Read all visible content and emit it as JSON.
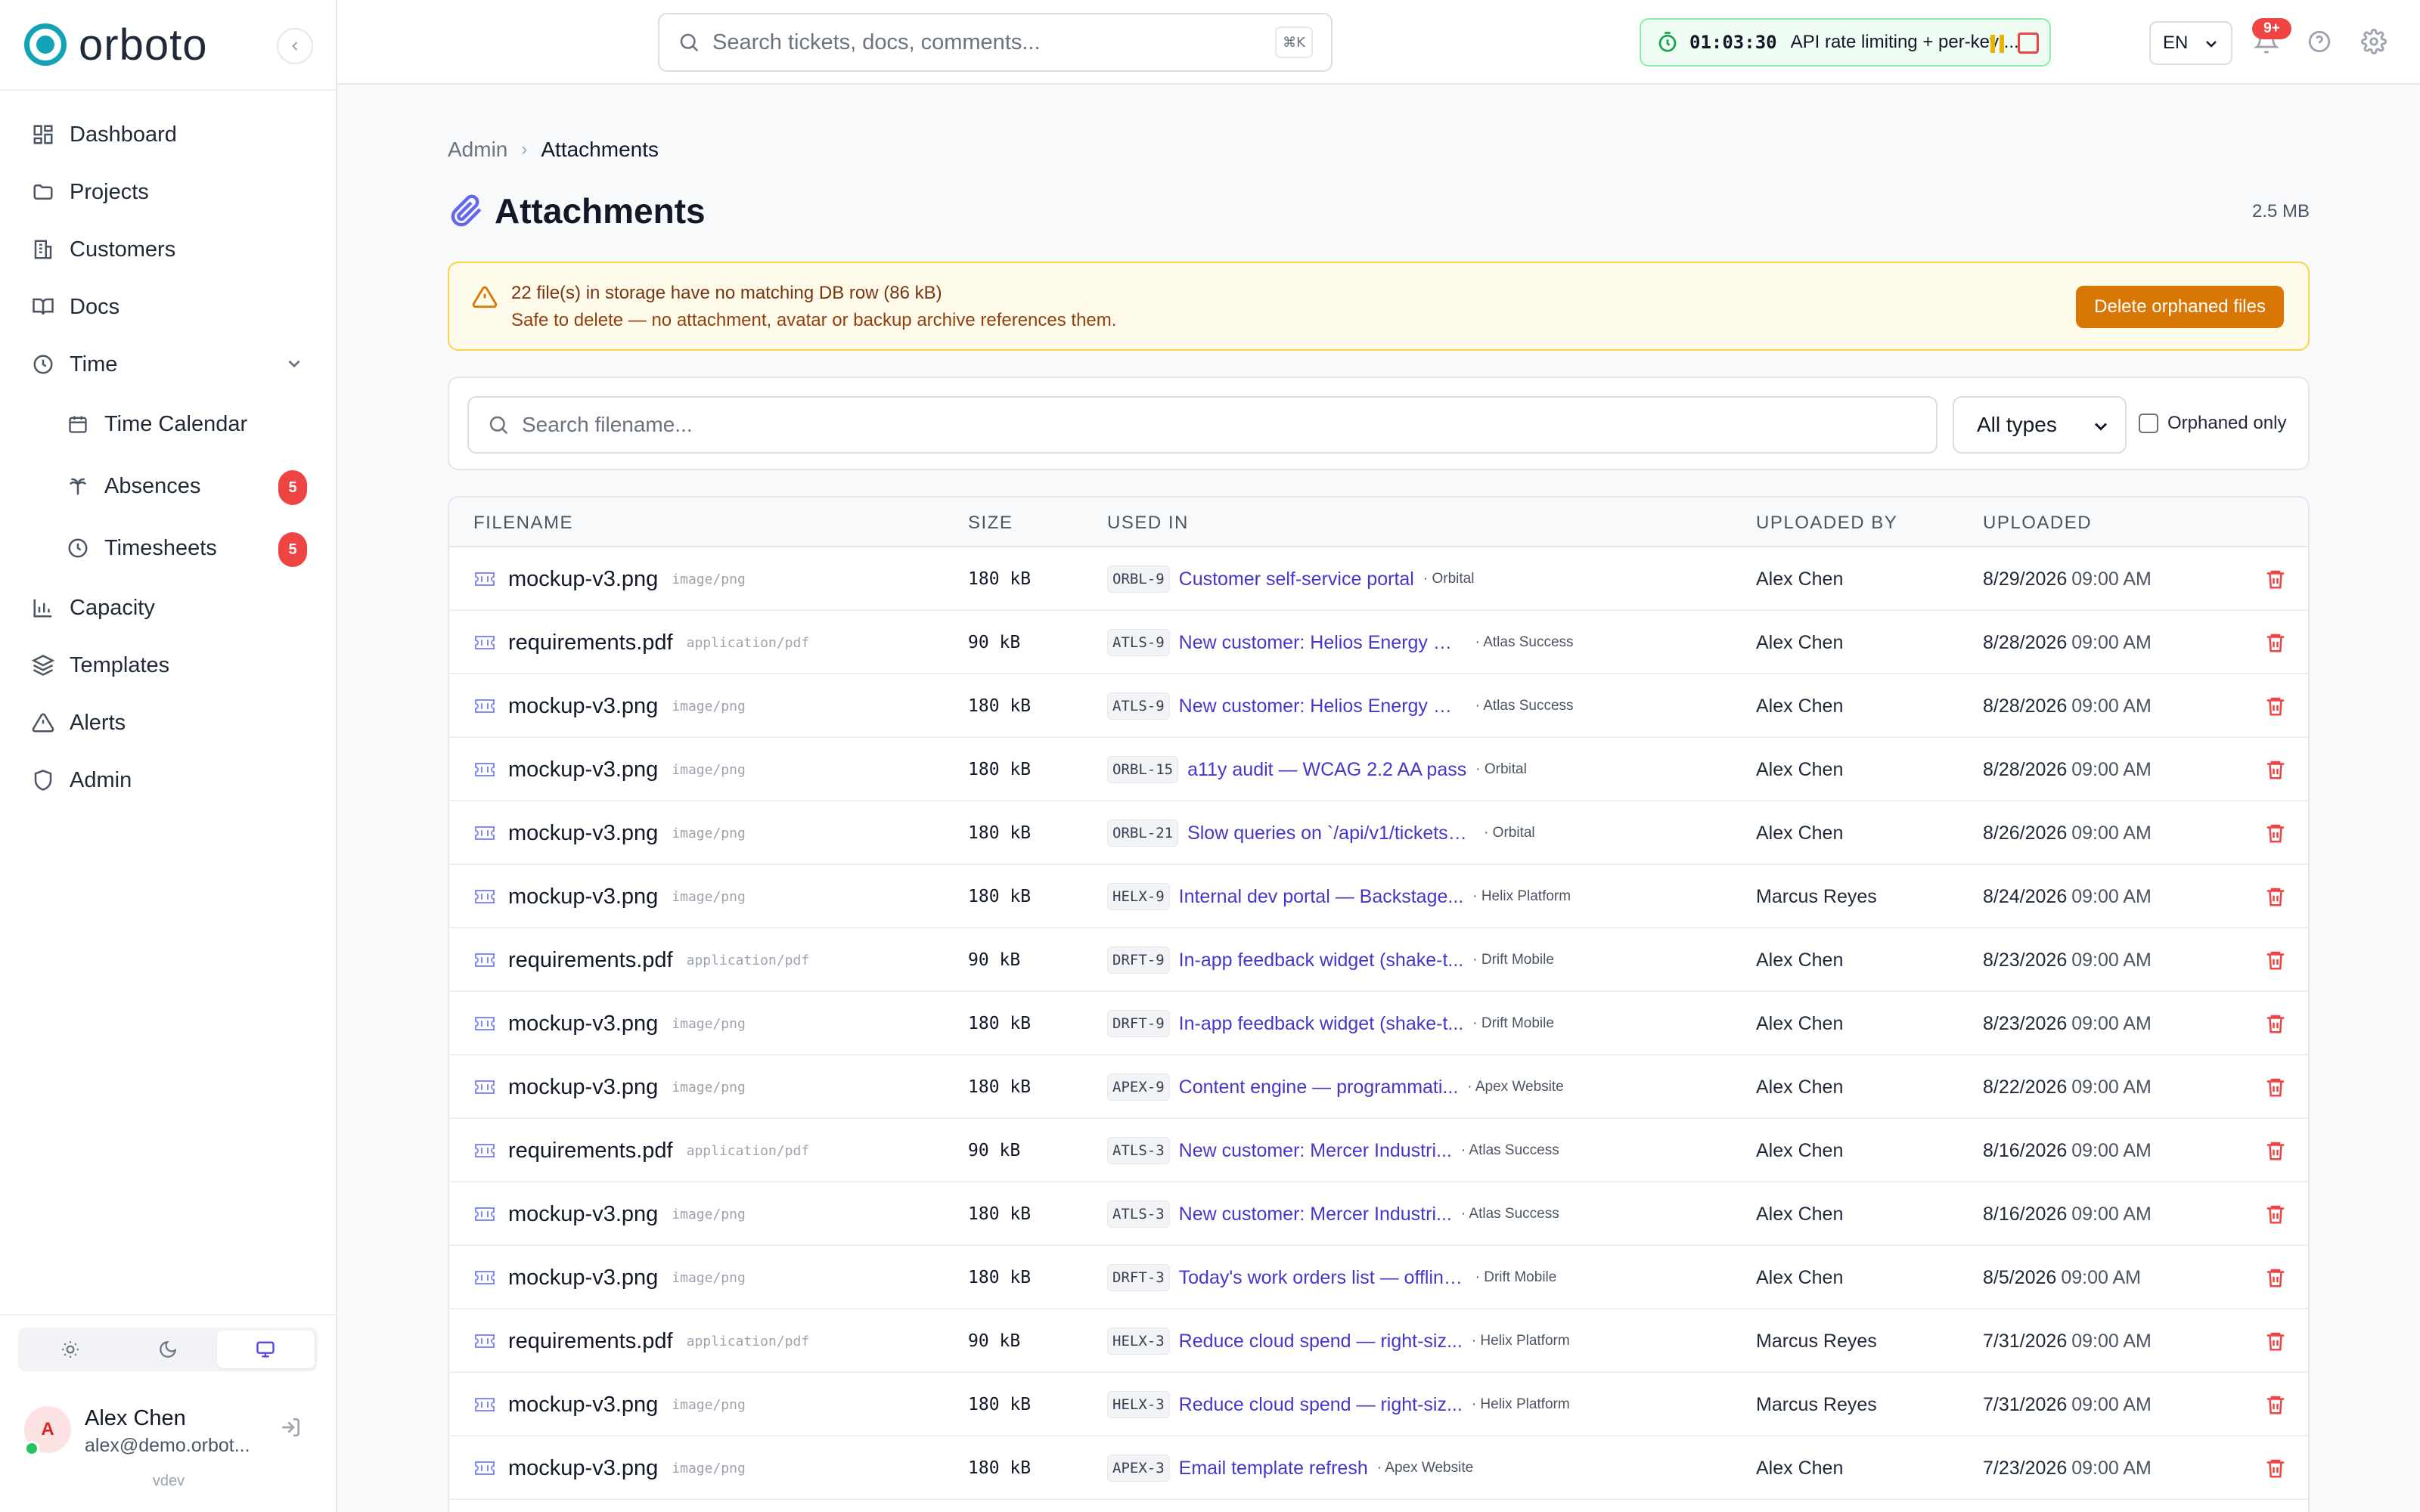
{
  "brand": {
    "name": "orboto"
  },
  "sidebar": {
    "items": [
      {
        "id": "dashboard",
        "label": "Dashboard",
        "icon": "grid-icon"
      },
      {
        "id": "projects",
        "label": "Projects",
        "icon": "folder-icon"
      },
      {
        "id": "customers",
        "label": "Customers",
        "icon": "building-icon"
      },
      {
        "id": "docs",
        "label": "Docs",
        "icon": "book-icon"
      },
      {
        "id": "time",
        "label": "Time",
        "icon": "clock-icon",
        "expanded": true
      },
      {
        "id": "time-calendar",
        "label": "Time Calendar",
        "icon": "calendar-icon",
        "sub": true
      },
      {
        "id": "absences",
        "label": "Absences",
        "icon": "palm-icon",
        "sub": true,
        "badge": "5"
      },
      {
        "id": "timesheets",
        "label": "Timesheets",
        "icon": "clock-icon",
        "sub": true,
        "badge": "5"
      },
      {
        "id": "capacity",
        "label": "Capacity",
        "icon": "bar-chart-icon"
      },
      {
        "id": "templates",
        "label": "Templates",
        "icon": "layers-icon"
      },
      {
        "id": "alerts",
        "label": "Alerts",
        "icon": "warning-icon"
      },
      {
        "id": "admin",
        "label": "Admin",
        "icon": "shield-icon"
      }
    ],
    "theme": {
      "active": "system"
    },
    "user": {
      "initial": "A",
      "name": "Alex Chen",
      "email": "alex@demo.orbot...",
      "env": "vdev"
    }
  },
  "topbar": {
    "search_placeholder": "Search tickets, docs, comments...",
    "search_shortcut": "⌘K",
    "timer": {
      "time": "01:03:30",
      "task": "API rate limiting + per-key ..."
    },
    "language": "EN",
    "notifications_badge": "9+"
  },
  "page": {
    "breadcrumb": {
      "parent": "Admin",
      "current": "Attachments"
    },
    "title": "Attachments",
    "total_size": "2.5 MB",
    "alert": {
      "title": "22 file(s) in storage have no matching DB row (86 kB)",
      "description": "Safe to delete — no attachment, avatar or backup archive references them.",
      "button": "Delete orphaned files"
    },
    "filters": {
      "search_placeholder": "Search filename...",
      "type_select": "All types",
      "orphaned_label": "Orphaned only"
    },
    "table": {
      "headers": {
        "filename": "FILENAME",
        "size": "SIZE",
        "used_in": "USED IN",
        "uploaded_by": "UPLOADED BY",
        "uploaded": "UPLOADED"
      },
      "rows": [
        {
          "filename": "mockup-v3.png",
          "mime": "image/png",
          "size": "180 kB",
          "key": "ORBL-9",
          "title": "Customer self-service portal",
          "project": "· Orbital",
          "by": "Alex Chen",
          "date": "8/29/2026",
          "time": "09:00 AM"
        },
        {
          "filename": "requirements.pdf",
          "mime": "application/pdf",
          "size": "90 kB",
          "key": "ATLS-9",
          "title": "New customer: Helios Energy —...",
          "project": "· Atlas Success",
          "by": "Alex Chen",
          "date": "8/28/2026",
          "time": "09:00 AM"
        },
        {
          "filename": "mockup-v3.png",
          "mime": "image/png",
          "size": "180 kB",
          "key": "ATLS-9",
          "title": "New customer: Helios Energy —...",
          "project": "· Atlas Success",
          "by": "Alex Chen",
          "date": "8/28/2026",
          "time": "09:00 AM"
        },
        {
          "filename": "mockup-v3.png",
          "mime": "image/png",
          "size": "180 kB",
          "key": "ORBL-15",
          "title": "a11y audit — WCAG 2.2 AA pass",
          "project": "· Orbital",
          "by": "Alex Chen",
          "date": "8/28/2026",
          "time": "09:00 AM"
        },
        {
          "filename": "mockup-v3.png",
          "mime": "image/png",
          "size": "180 kB",
          "key": "ORBL-21",
          "title": "Slow queries on `/api/v1/tickets?inclu...",
          "project": "· Orbital",
          "by": "Alex Chen",
          "date": "8/26/2026",
          "time": "09:00 AM"
        },
        {
          "filename": "mockup-v3.png",
          "mime": "image/png",
          "size": "180 kB",
          "key": "HELX-9",
          "title": "Internal dev portal — Backstage...",
          "project": "· Helix Platform",
          "by": "Marcus Reyes",
          "date": "8/24/2026",
          "time": "09:00 AM"
        },
        {
          "filename": "requirements.pdf",
          "mime": "application/pdf",
          "size": "90 kB",
          "key": "DRFT-9",
          "title": "In-app feedback widget (shake-t...",
          "project": "· Drift Mobile",
          "by": "Alex Chen",
          "date": "8/23/2026",
          "time": "09:00 AM"
        },
        {
          "filename": "mockup-v3.png",
          "mime": "image/png",
          "size": "180 kB",
          "key": "DRFT-9",
          "title": "In-app feedback widget (shake-t...",
          "project": "· Drift Mobile",
          "by": "Alex Chen",
          "date": "8/23/2026",
          "time": "09:00 AM"
        },
        {
          "filename": "mockup-v3.png",
          "mime": "image/png",
          "size": "180 kB",
          "key": "APEX-9",
          "title": "Content engine — programmati...",
          "project": "· Apex Website",
          "by": "Alex Chen",
          "date": "8/22/2026",
          "time": "09:00 AM"
        },
        {
          "filename": "requirements.pdf",
          "mime": "application/pdf",
          "size": "90 kB",
          "key": "ATLS-3",
          "title": "New customer: Mercer Industri...",
          "project": "· Atlas Success",
          "by": "Alex Chen",
          "date": "8/16/2026",
          "time": "09:00 AM"
        },
        {
          "filename": "mockup-v3.png",
          "mime": "image/png",
          "size": "180 kB",
          "key": "ATLS-3",
          "title": "New customer: Mercer Industri...",
          "project": "· Atlas Success",
          "by": "Alex Chen",
          "date": "8/16/2026",
          "time": "09:00 AM"
        },
        {
          "filename": "mockup-v3.png",
          "mime": "image/png",
          "size": "180 kB",
          "key": "DRFT-3",
          "title": "Today's work orders list — offline...",
          "project": "· Drift Mobile",
          "by": "Alex Chen",
          "date": "8/5/2026",
          "time": "09:00 AM"
        },
        {
          "filename": "requirements.pdf",
          "mime": "application/pdf",
          "size": "90 kB",
          "key": "HELX-3",
          "title": "Reduce cloud spend — right-siz...",
          "project": "· Helix Platform",
          "by": "Marcus Reyes",
          "date": "7/31/2026",
          "time": "09:00 AM"
        },
        {
          "filename": "mockup-v3.png",
          "mime": "image/png",
          "size": "180 kB",
          "key": "HELX-3",
          "title": "Reduce cloud spend — right-siz...",
          "project": "· Helix Platform",
          "by": "Marcus Reyes",
          "date": "7/31/2026",
          "time": "09:00 AM"
        },
        {
          "filename": "mockup-v3.png",
          "mime": "image/png",
          "size": "180 kB",
          "key": "APEX-3",
          "title": "Email template refresh",
          "project": "· Apex Website",
          "by": "Alex Chen",
          "date": "7/23/2026",
          "time": "09:00 AM"
        }
      ]
    }
  },
  "colors": {
    "accent": "#4338ca",
    "brand": "#13a3b7",
    "danger": "#ef4444",
    "warning": "#d97706"
  }
}
